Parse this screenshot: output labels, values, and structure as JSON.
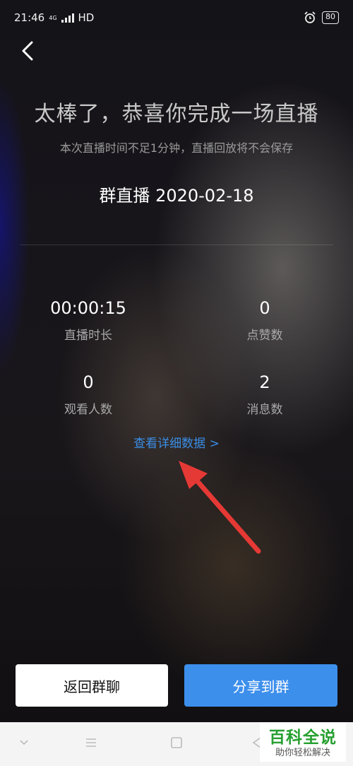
{
  "status_bar": {
    "time": "21:46",
    "network": "4G",
    "hd": "HD",
    "battery": "80"
  },
  "header": {
    "title": "太棒了，恭喜你完成一场直播",
    "subtitle": "本次直播时间不足1分钟，直播回放将不会保存",
    "session": "群直播 2020-02-18"
  },
  "stats": [
    {
      "value": "00:00:15",
      "label": "直播时长"
    },
    {
      "value": "0",
      "label": "点赞数"
    },
    {
      "value": "0",
      "label": "观看人数"
    },
    {
      "value": "2",
      "label": "消息数"
    }
  ],
  "detail_link": "查看详细数据 >",
  "buttons": {
    "back_to_group": "返回群聊",
    "share_to_group": "分享到群"
  },
  "watermark": {
    "title": "百科全说",
    "subtitle": "助你轻松解决"
  },
  "colors": {
    "accent": "#3d8fec",
    "link": "#3a8ee6",
    "annotation_arrow": "#e53935"
  }
}
